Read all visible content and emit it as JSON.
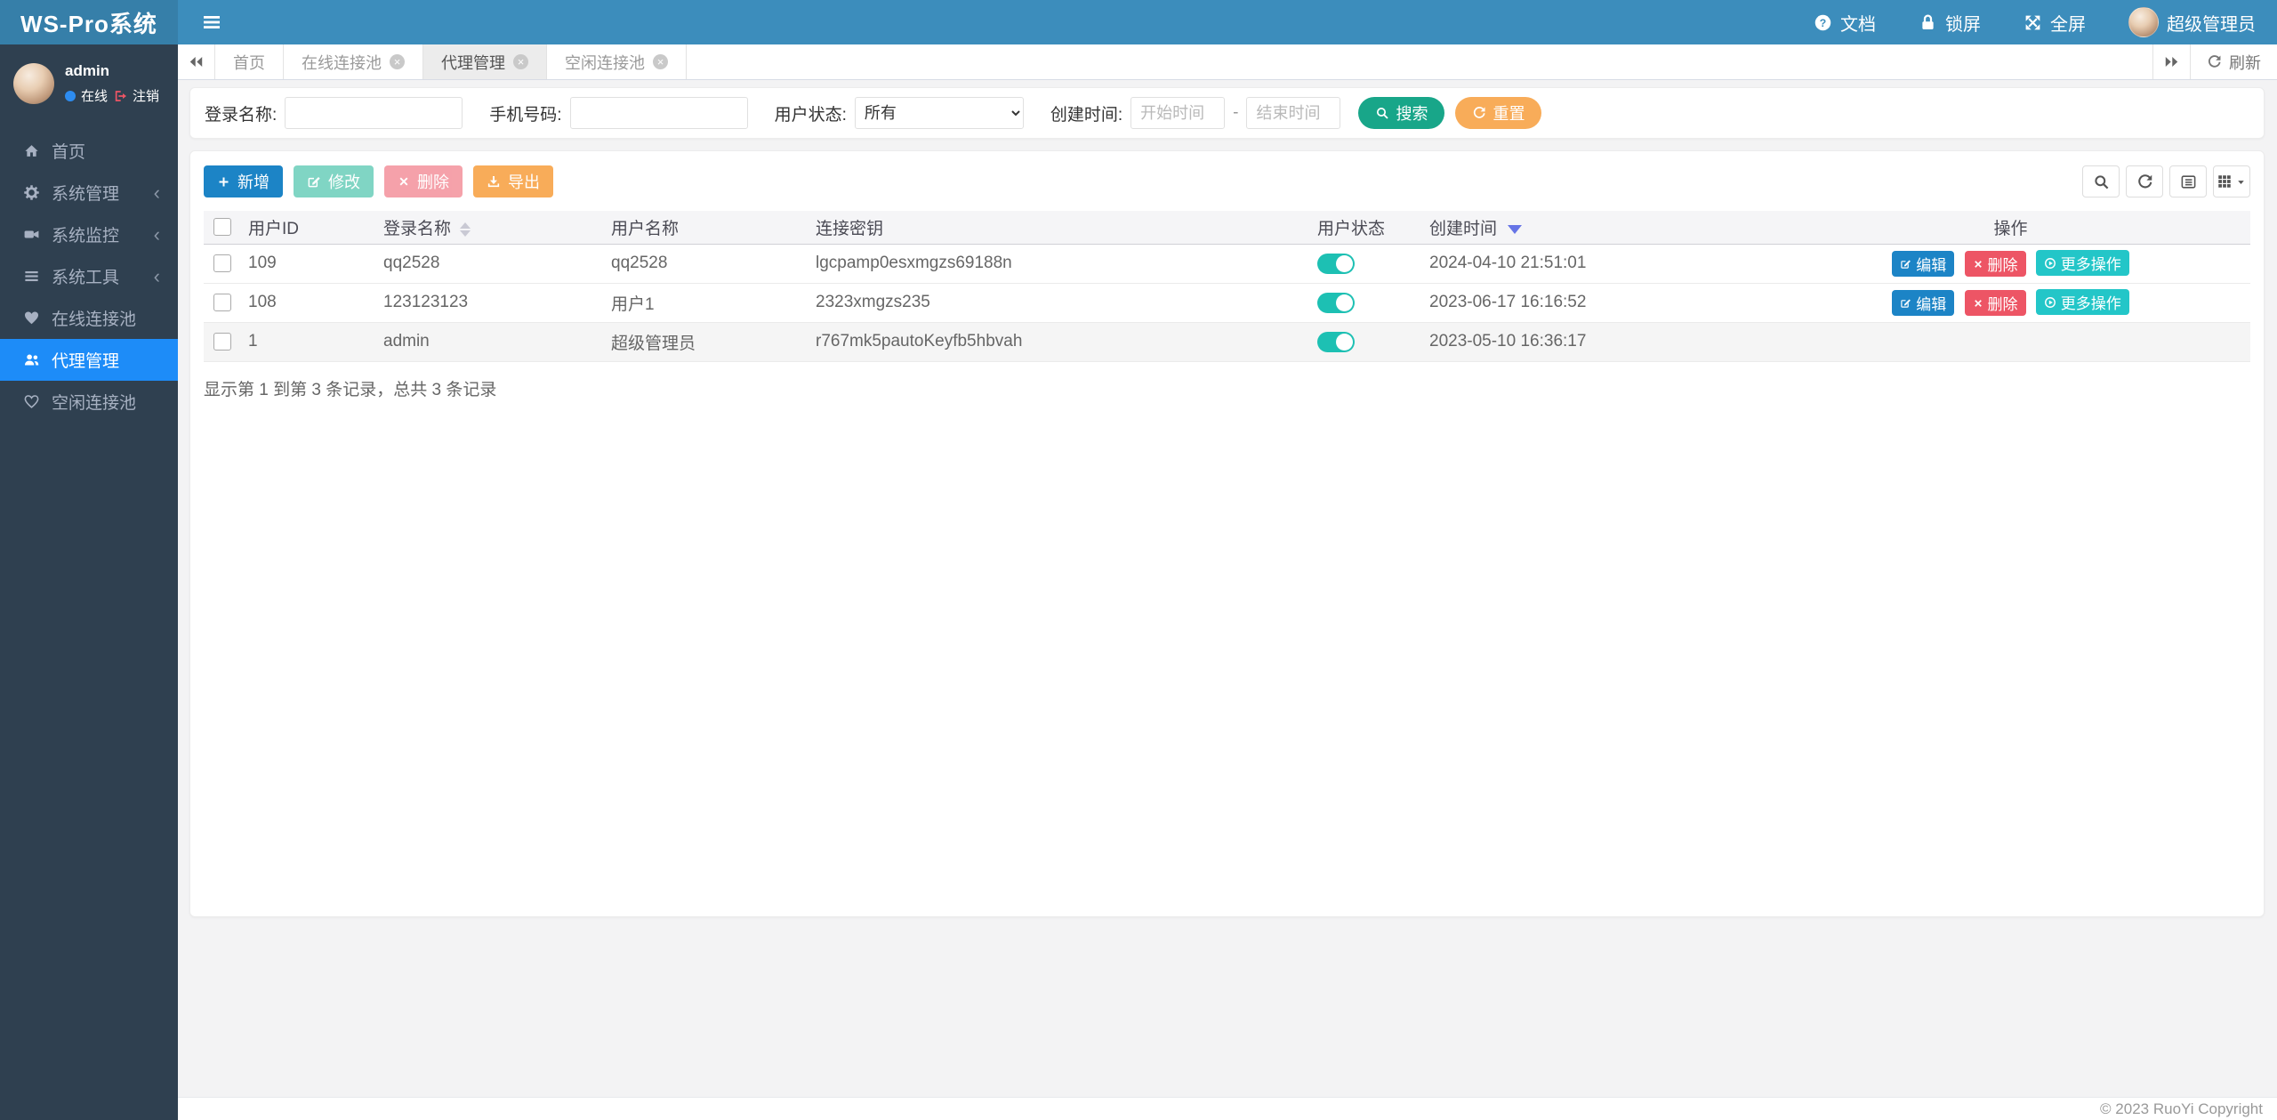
{
  "app": {
    "title": "WS-Pro系统"
  },
  "header": {
    "doc": "文档",
    "lock": "锁屏",
    "fullscreen": "全屏",
    "user": "超级管理员"
  },
  "user_panel": {
    "name": "admin",
    "status": "在线",
    "logout": "注销"
  },
  "sidebar": {
    "items": [
      {
        "label": "首页"
      },
      {
        "label": "系统管理"
      },
      {
        "label": "系统监控"
      },
      {
        "label": "系统工具"
      },
      {
        "label": "在线连接池"
      },
      {
        "label": "代理管理"
      },
      {
        "label": "空闲连接池"
      }
    ]
  },
  "tabs": {
    "items": [
      {
        "label": "首页"
      },
      {
        "label": "在线连接池"
      },
      {
        "label": "代理管理"
      },
      {
        "label": "空闲连接池"
      }
    ],
    "refresh": "刷新"
  },
  "search": {
    "login_label": "登录名称:",
    "phone_label": "手机号码:",
    "status_label": "用户状态:",
    "status_value": "所有",
    "time_label": "创建时间:",
    "start_placeholder": "开始时间",
    "end_placeholder": "结束时间",
    "separator": "-",
    "search_btn": "搜索",
    "reset_btn": "重置"
  },
  "toolbar": {
    "add": "新增",
    "edit": "修改",
    "delete": "删除",
    "export": "导出"
  },
  "table": {
    "columns": {
      "id": "用户ID",
      "login": "登录名称",
      "name": "用户名称",
      "key": "连接密钥",
      "status": "用户状态",
      "created": "创建时间",
      "actions": "操作"
    },
    "rows": [
      {
        "id": "109",
        "login": "qq2528",
        "name": "qq2528",
        "key": "lgcpamp0esxmgzs69188n",
        "created": "2024-04-10 21:51:01"
      },
      {
        "id": "108",
        "login": "123123123",
        "name": "用户1",
        "key": "2323xmgzs235",
        "created": "2023-06-17 16:16:52"
      },
      {
        "id": "1",
        "login": "admin",
        "name": "超级管理员",
        "key": "r767mk5pautoKeyfb5hbvah",
        "created": "2023-05-10 16:36:17"
      }
    ],
    "row_actions": {
      "edit": "编辑",
      "delete": "删除",
      "more": "更多操作"
    },
    "summary": "显示第 1 到第 3 条记录，总共 3 条记录"
  },
  "footer": {
    "copyright": "© 2023 RuoYi Copyright"
  },
  "colors": {
    "navbar": "#3c8dbc",
    "logo_bg": "#367fa9",
    "sidebar_bg": "#2f4050",
    "sidebar_active": "#1d8cf8",
    "primary": "#1c84c6",
    "success": "#1ab394",
    "danger": "#ed5565",
    "warning": "#f8ac59",
    "info": "#23c6c8",
    "search_green": "#18a689",
    "toggle_on": "#1dc0b3",
    "sort_active": "#6674e6"
  }
}
